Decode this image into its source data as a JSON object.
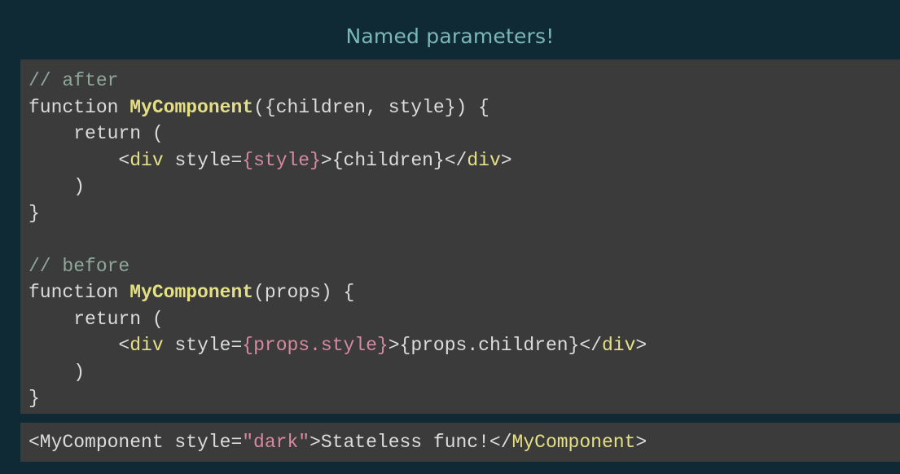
{
  "slide": {
    "title": "Named parameters!"
  },
  "colors": {
    "background": "#0f2a35",
    "panel": "#3b3b3b",
    "title": "#7ab8b6",
    "comment": "#8fa89b",
    "function_name": "#e6e085",
    "expression": "#d58aa0",
    "text": "#dcdcdc"
  },
  "code": {
    "lines": [
      [
        {
          "t": "// after",
          "k": "comment"
        }
      ],
      [
        {
          "t": "function ",
          "k": "keyword"
        },
        {
          "t": "MyComponent",
          "k": "fn"
        },
        {
          "t": "({children, style}) {",
          "k": "plain"
        }
      ],
      [
        {
          "t": "    return (",
          "k": "keyword"
        }
      ],
      [
        {
          "t": "        <",
          "k": "plain"
        },
        {
          "t": "div",
          "k": "tag"
        },
        {
          "t": " style=",
          "k": "plain"
        },
        {
          "t": "{style}",
          "k": "expr"
        },
        {
          "t": ">{children}</",
          "k": "plain"
        },
        {
          "t": "div",
          "k": "tag"
        },
        {
          "t": ">",
          "k": "plain"
        }
      ],
      [
        {
          "t": "    )",
          "k": "plain"
        }
      ],
      [
        {
          "t": "}",
          "k": "plain"
        }
      ],
      [
        {
          "t": "",
          "k": "plain"
        }
      ],
      [
        {
          "t": "// before",
          "k": "comment"
        }
      ],
      [
        {
          "t": "function ",
          "k": "keyword"
        },
        {
          "t": "MyComponent",
          "k": "fn"
        },
        {
          "t": "(props) {",
          "k": "plain"
        }
      ],
      [
        {
          "t": "    return (",
          "k": "keyword"
        }
      ],
      [
        {
          "t": "        <",
          "k": "plain"
        },
        {
          "t": "div",
          "k": "tag"
        },
        {
          "t": " style=",
          "k": "plain"
        },
        {
          "t": "{props.style}",
          "k": "expr"
        },
        {
          "t": ">{props.children}</",
          "k": "plain"
        },
        {
          "t": "div",
          "k": "tag"
        },
        {
          "t": ">",
          "k": "plain"
        }
      ],
      [
        {
          "t": "    )",
          "k": "plain"
        }
      ],
      [
        {
          "t": "}",
          "k": "plain"
        }
      ]
    ]
  },
  "usage": {
    "tokens": [
      {
        "t": "<MyComponent style=",
        "k": "plain"
      },
      {
        "t": "\"dark\"",
        "k": "string"
      },
      {
        "t": ">Stateless func!</",
        "k": "plain"
      },
      {
        "t": "MyComponent",
        "k": "tag"
      },
      {
        "t": ">",
        "k": "plain"
      }
    ]
  }
}
